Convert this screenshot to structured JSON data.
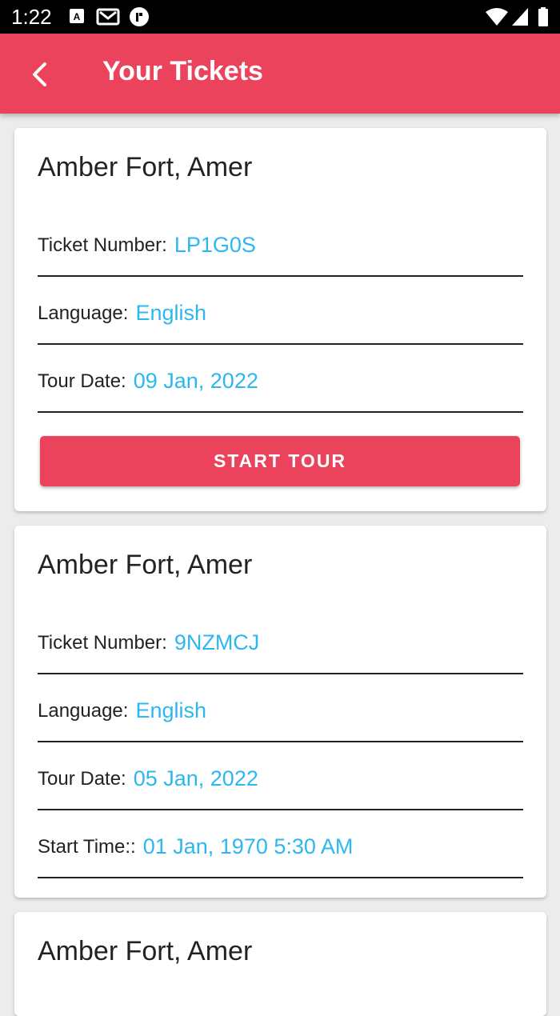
{
  "status_bar": {
    "time": "1:22",
    "left_icons": [
      "a-badge-icon",
      "gmail-icon",
      "fiverr-icon"
    ],
    "right_icons": [
      "wifi-icon",
      "signal-icon",
      "battery-icon"
    ]
  },
  "app_bar": {
    "title": "Your Tickets",
    "back_icon": "back-arrow-icon",
    "color": "#eb435b"
  },
  "colors": {
    "accent": "#eb435b",
    "value_text": "#2db7f0"
  },
  "tickets": [
    {
      "place": "Amber Fort, Amer",
      "ticket_number_label": "Ticket Number:",
      "ticket_number": "LP1G0S",
      "language_label": "Language:",
      "language": "English",
      "tour_date_label": "Tour Date:",
      "tour_date": "09 Jan, 2022",
      "button_label": "START TOUR"
    },
    {
      "place": "Amber Fort, Amer",
      "ticket_number_label": "Ticket Number:",
      "ticket_number": "9NZMCJ",
      "language_label": "Language:",
      "language": "English",
      "tour_date_label": "Tour Date:",
      "tour_date": "05 Jan, 2022",
      "start_time_label": "Start Time::",
      "start_time": "01 Jan, 1970 5:30 AM"
    },
    {
      "place": "Amber Fort, Amer"
    }
  ]
}
